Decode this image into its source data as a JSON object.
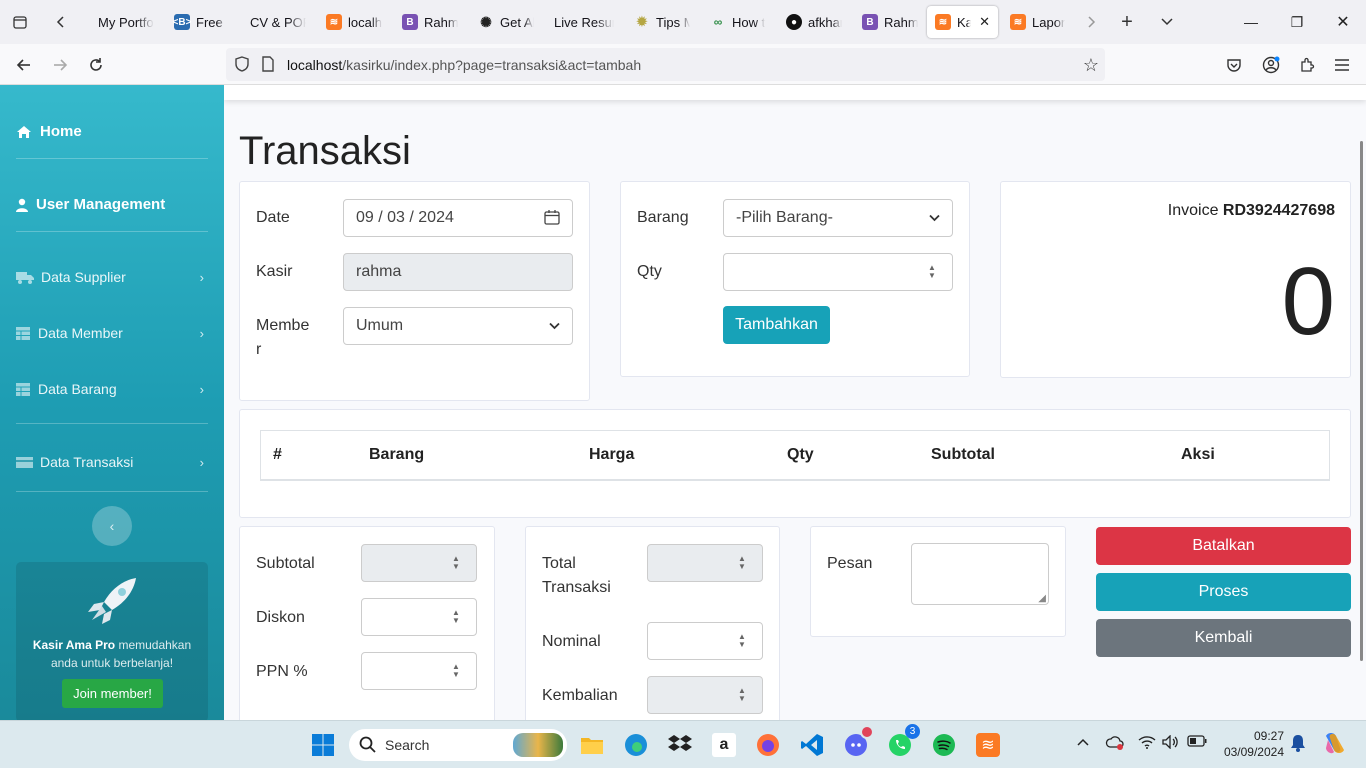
{
  "browser": {
    "tabs": [
      {
        "label": "My Portfo",
        "icon": "globe-icon",
        "color": "#444444"
      },
      {
        "label": "Free B",
        "icon": "bootstrap-icon",
        "color": "#2b6cb0"
      },
      {
        "label": "CV & POR",
        "icon": "doc-icon",
        "color": "#444444"
      },
      {
        "label": "localh",
        "icon": "xampp-icon",
        "color": "#fb7a24"
      },
      {
        "label": "Rahm",
        "icon": "bootstrap-icon",
        "color": "#7952b3"
      },
      {
        "label": "Get Al",
        "icon": "openai-icon",
        "color": "#222222"
      },
      {
        "label": "Live Resun",
        "icon": "doc-icon",
        "color": "#444444"
      },
      {
        "label": "Tips M",
        "icon": "gear-icon",
        "color": "#b5a642"
      },
      {
        "label": "How t",
        "icon": "gfg-icon",
        "color": "#2f8d46"
      },
      {
        "label": "afkhar",
        "icon": "github-icon",
        "color": "#111111"
      },
      {
        "label": "Rahm",
        "icon": "bootstrap-icon",
        "color": "#7952b3"
      },
      {
        "label": "Kas",
        "icon": "xampp-icon",
        "color": "#fb7a24",
        "active": true
      },
      {
        "label": "Lapor",
        "icon": "xampp-icon",
        "color": "#fb7a24"
      }
    ],
    "url_host": "localhost",
    "url_path": "/kasirku/index.php?page=transaksi&act=tambah"
  },
  "sidebar": {
    "home": "Home",
    "user_management": "User Management",
    "data_supplier": "Data Supplier",
    "data_member": "Data Member",
    "data_barang": "Data Barang",
    "data_transaksi": "Data Transaksi",
    "promo_brand": "Kasir Ama Pro",
    "promo_text": " memudahkan anda untuk berbelanja!",
    "join_label": "Join member!"
  },
  "page": {
    "title": "Transaksi",
    "date_label": "Date",
    "date_value": "09 / 03 / 2024",
    "kasir_label": "Kasir",
    "kasir_value": "rahma",
    "member_label_1": "Membe",
    "member_label_2": "r",
    "member_value": "Umum",
    "barang_label": "Barang",
    "barang_value": "-Pilih Barang-",
    "qty_label": "Qty",
    "qty_value": "",
    "tambahkan_label": "Tambahkan",
    "invoice_prefix": "Invoice ",
    "invoice_number": "RD3924427698",
    "grand_total": "0",
    "table_headers": [
      "#",
      "Barang",
      "Harga",
      "Qty",
      "Subtotal",
      "Aksi"
    ],
    "subtotal_label": "Subtotal",
    "diskon_label": "Diskon",
    "ppn_label": "PPN %",
    "total_transaksi_label_1": "Total",
    "total_transaksi_label_2": "Transaksi",
    "nominal_label": "Nominal",
    "kembalian_label": "Kembalian",
    "pesan_label": "Pesan",
    "batalkan_label": "Batalkan",
    "proses_label": "Proses",
    "kembali_label": "Kembali"
  },
  "colors": {
    "sidebar_top": "#36b9cc",
    "primary_btn": "#17a2b8",
    "danger_btn": "#dc3545",
    "secondary_btn": "#6c757d",
    "success_btn": "#28a745"
  },
  "taskbar": {
    "search_label": "Search",
    "time": "09:27",
    "date": "03/09/2024",
    "vscode_badge": "",
    "discord_badge": "",
    "whatsapp_badge": "3"
  }
}
